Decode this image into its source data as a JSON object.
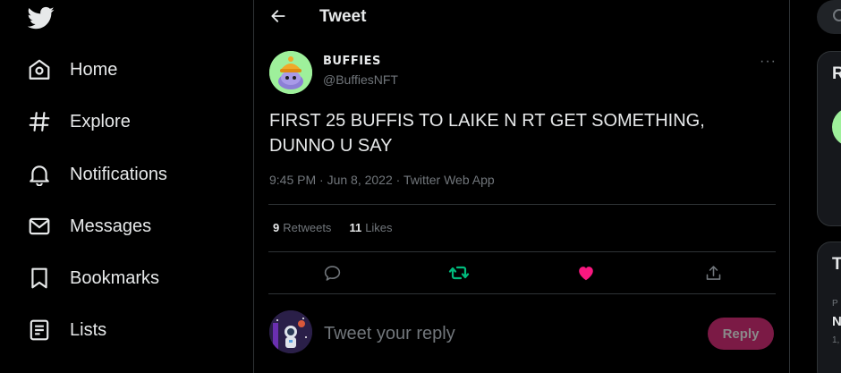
{
  "nav": {
    "logo_icon": "twitter-bird-icon",
    "items": [
      {
        "label": "Home",
        "icon": "home-icon"
      },
      {
        "label": "Explore",
        "icon": "hashtag-icon"
      },
      {
        "label": "Notifications",
        "icon": "bell-icon"
      },
      {
        "label": "Messages",
        "icon": "envelope-icon"
      },
      {
        "label": "Bookmarks",
        "icon": "bookmark-icon"
      },
      {
        "label": "Lists",
        "icon": "list-icon"
      }
    ]
  },
  "header": {
    "title": "Tweet",
    "back_icon": "arrow-left-icon"
  },
  "tweet": {
    "author_name": "BUFFIES",
    "author_handle": "@BuffiesNFT",
    "text": "FIRST 25 BUFFIS TO LAIKE N RT GET SOMETHING, DUNNO U SAY",
    "time": "9:45 PM · Jun 8, 2022",
    "separator": " · ",
    "source": "Twitter Web App",
    "retweets_count": "9",
    "retweets_label": "Retweets",
    "likes_count": "11",
    "likes_label": "Likes",
    "more_label": "···"
  },
  "actions": {
    "reply_icon": "comment-icon",
    "retweet_icon": "retweet-icon",
    "like_icon": "heart-icon",
    "share_icon": "share-icon",
    "retweet_color": "#00ba7c",
    "like_color": "#f91880"
  },
  "reply": {
    "placeholder": "Tweet your reply",
    "button_label": "Reply"
  },
  "right": {
    "panel1_title": "R",
    "panel2_title": "T",
    "panel2_small_1": "P",
    "panel2_bold": "N",
    "panel2_small_2": "1,"
  },
  "colors": {
    "background": "#000000",
    "text": "#e7e9ea",
    "muted": "#71767b",
    "border": "#2f3336",
    "reply_button": "#7b1a45"
  }
}
